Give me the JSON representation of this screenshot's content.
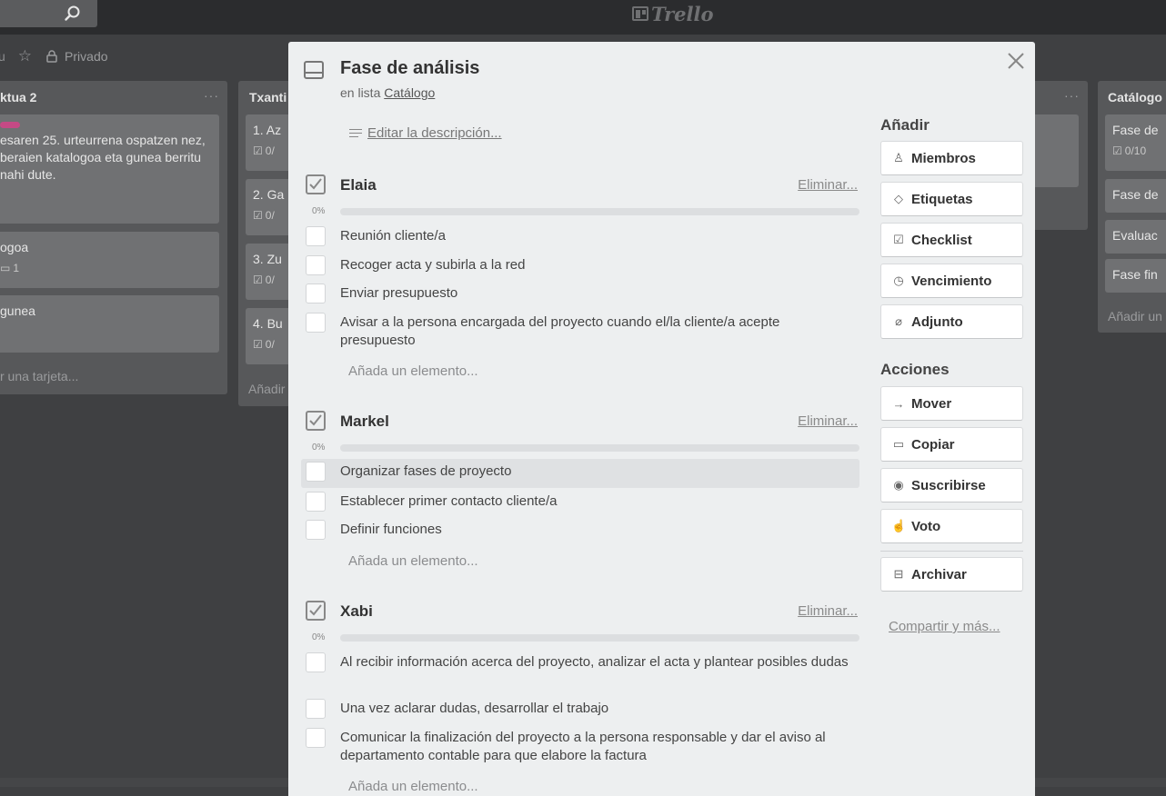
{
  "app": {
    "logo_text": "Trello"
  },
  "board": {
    "header_dash": "u",
    "privacy_label": "Privado",
    "lists": [
      {
        "title": "ktua 2",
        "cards": [
          {
            "text": "esaren 25. urteurrena ospatzen nez, beraien katalogoa eta gunea berritu nahi dute."
          },
          {
            "text": "ogoa",
            "badge": "1"
          },
          {
            "text": "gunea"
          }
        ],
        "add_label": "r una tarjeta..."
      },
      {
        "title": "Txanti",
        "cards": [
          {
            "text": "1. Az",
            "badge": "0/"
          },
          {
            "text": "2. Ga",
            "badge": "0/"
          },
          {
            "text": "3. Zu",
            "badge": "0/"
          },
          {
            "text": "4. Bu",
            "badge": "0/"
          }
        ],
        "add_label": "Añadir"
      },
      {
        "title": "Catálogo",
        "cards": [
          {
            "text": "Fase de",
            "badge": "0/10"
          },
          {
            "text": "Fase de"
          },
          {
            "text": "Evaluac"
          },
          {
            "text": "Fase fin"
          }
        ],
        "add_label": "Añadir un"
      }
    ]
  },
  "card": {
    "title": "Fase de análisis",
    "in_list_prefix": "en lista",
    "list_name": "Catálogo",
    "edit_description": "Editar la descripción..."
  },
  "checklists": [
    {
      "title": "Elaia",
      "delete_label": "Eliminar...",
      "progress_label": "0%",
      "progress": 0,
      "items": [
        "Reunión cliente/a",
        "Recoger acta y subirla a la red",
        "Enviar presupuesto",
        "Avisar a la persona encargada del proyecto cuando el/la cliente/a acepte presupuesto"
      ],
      "add_placeholder": "Añada un elemento..."
    },
    {
      "title": "Markel",
      "delete_label": "Eliminar...",
      "progress_label": "0%",
      "progress": 0,
      "items": [
        "Organizar fases de proyecto",
        "Establecer primer contacto cliente/a",
        "Definir funciones"
      ],
      "add_placeholder": "Añada un elemento..."
    },
    {
      "title": "Xabi",
      "delete_label": "Eliminar...",
      "progress_label": "0%",
      "progress": 0,
      "items": [
        "Al recibir información acerca del proyecto, analizar el acta y plantear posibles dudas",
        "Una vez aclarar dudas, desarrollar el trabajo",
        "Comunicar la finalización del proyecto a la persona responsable y dar el aviso al departamento contable para que elabore la factura"
      ],
      "add_placeholder": "Añada un elemento..."
    }
  ],
  "sidebar": {
    "add_heading": "Añadir",
    "add_buttons": [
      {
        "label": "Miembros",
        "icon": "person-icon"
      },
      {
        "label": "Etiquetas",
        "icon": "tag-icon"
      },
      {
        "label": "Checklist",
        "icon": "checklist-icon"
      },
      {
        "label": "Vencimiento",
        "icon": "clock-icon"
      },
      {
        "label": "Adjunto",
        "icon": "paperclip-icon"
      }
    ],
    "actions_heading": "Acciones",
    "action_buttons": [
      {
        "label": "Mover",
        "icon": "arrow-right-icon"
      },
      {
        "label": "Copiar",
        "icon": "card-icon"
      },
      {
        "label": "Suscribirse",
        "icon": "eye-icon"
      },
      {
        "label": "Voto",
        "icon": "thumbs-up-icon"
      }
    ],
    "archive_button": {
      "label": "Archivar",
      "icon": "archive-icon"
    },
    "share_link": "Compartir y más..."
  }
}
